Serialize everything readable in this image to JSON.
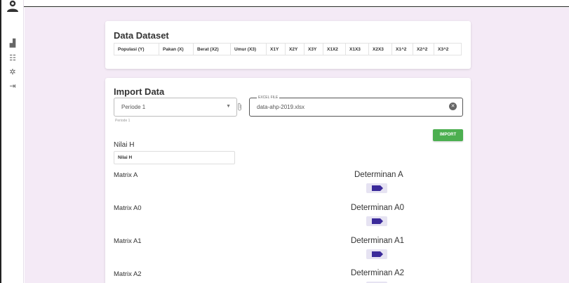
{
  "sidebar": {
    "avatar_icon": "user-icon",
    "items": [
      {
        "icon": "dashboard-icon",
        "glyph": "▟"
      },
      {
        "icon": "data-icon",
        "glyph": "☷"
      },
      {
        "icon": "settings-icon",
        "glyph": "✲"
      },
      {
        "icon": "logout-icon",
        "glyph": "⇥"
      }
    ]
  },
  "dataset": {
    "title": "Data Dataset",
    "columns": [
      "Populasi (Y)",
      "Pakan (X)",
      "Berat (X2)",
      "Umur (X3)",
      "X1Y",
      "X2Y",
      "X3Y",
      "X1X2",
      "X1X3",
      "X2X3",
      "X1^2",
      "X2^2",
      "X3^2"
    ]
  },
  "import": {
    "title": "Import Data",
    "period_select": {
      "value": "Periode 1",
      "hint": "Periode 1"
    },
    "file_field": {
      "legend": "EXCEL FILE",
      "value": "data-ahp-2019.xlsx"
    },
    "import_button": "IMPORT",
    "nilai_h_label": "Nilai H",
    "nilai_h_placeholder": "Nilai H",
    "matrices": [
      {
        "label": "Matrix A",
        "det_label": "Determinan A"
      },
      {
        "label": "Matrix A0",
        "det_label": "Determinan A0"
      },
      {
        "label": "Matrix A1",
        "det_label": "Determinan A1"
      },
      {
        "label": "Matrix A2",
        "det_label": "Determinan A2"
      }
    ]
  },
  "colors": {
    "background": "#f4eaf6",
    "import_button": "#4caf50",
    "det_badge_bg": "#e6e3f2",
    "det_badge_icon": "#3b2a9a"
  }
}
